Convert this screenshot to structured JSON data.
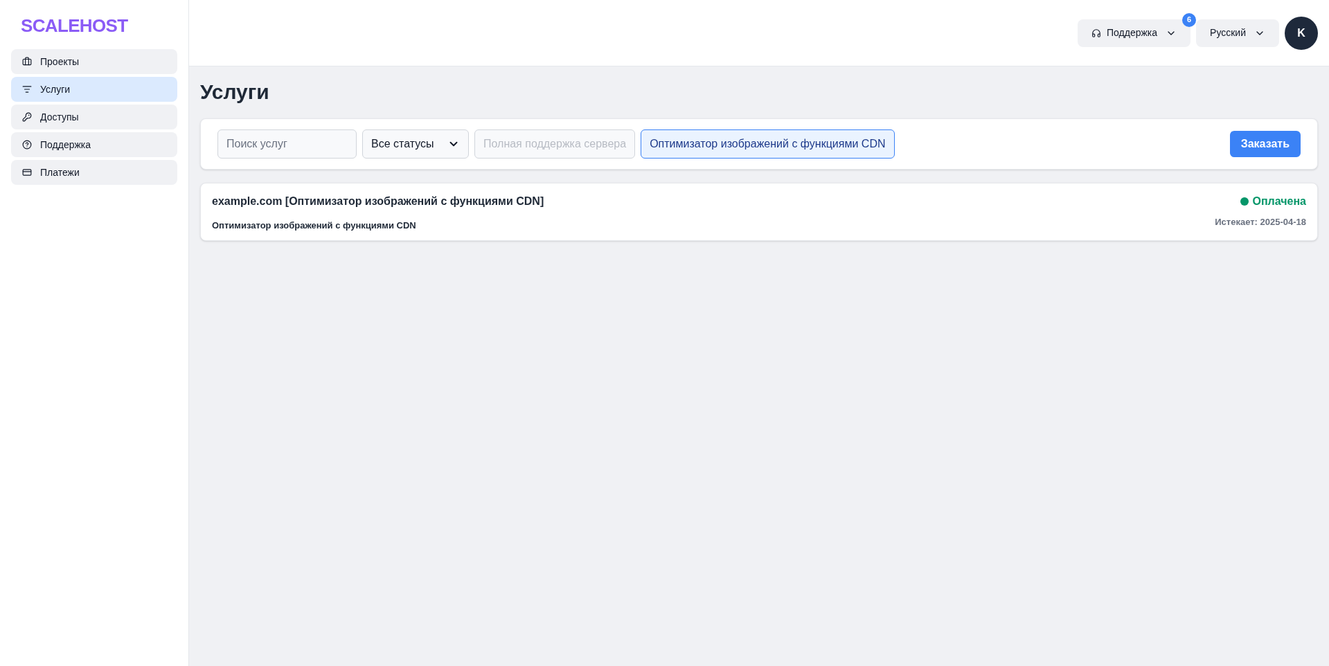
{
  "logo": "SCALEHOST",
  "sidebar": {
    "items": [
      {
        "label": "Проекты",
        "selected": false
      },
      {
        "label": "Услуги",
        "selected": true
      },
      {
        "label": "Доступы",
        "selected": false
      },
      {
        "label": "Поддержка",
        "selected": false
      },
      {
        "label": "Платежи",
        "selected": false
      }
    ]
  },
  "header": {
    "support": {
      "label": "Поддержка",
      "badge": "6"
    },
    "language": "Русский",
    "avatar": "K"
  },
  "page_title": "Услуги",
  "filters": {
    "search": {
      "placeholder": "Поиск услуг"
    },
    "status": {
      "value": "Все статусы"
    },
    "options": [
      {
        "label": "Полная поддержка сервера",
        "selected": false,
        "disabled": true
      },
      {
        "label": "Оптимизатор изображений с функциями CDN",
        "selected": true,
        "disabled": false
      }
    ],
    "order_button": "Заказать"
  },
  "services": [
    {
      "title": "example.com [Оптимизатор изображений с функциями CDN]",
      "subtitle": "Оптимизатор изображений с функциями CDN",
      "status": "Оплачена",
      "color": "#059669",
      "expires": "Истекает: 2025-04-18"
    }
  ]
}
